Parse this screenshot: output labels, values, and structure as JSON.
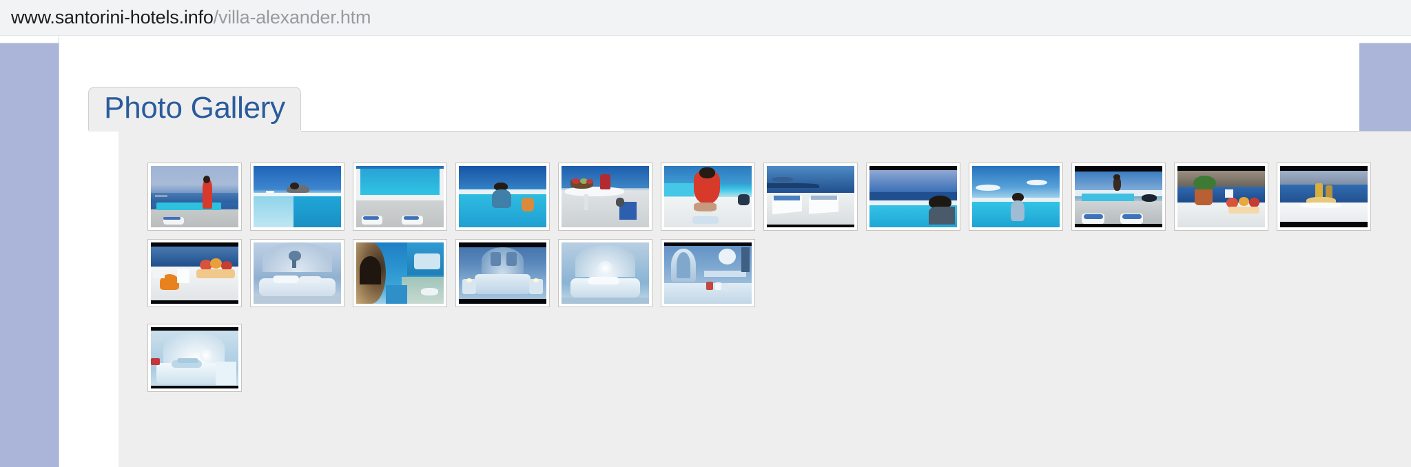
{
  "browser": {
    "url_domain": "www.santorini-hotels.info",
    "url_path": "/villa-alexander.htm"
  },
  "page": {
    "tab_label": "Photo Gallery",
    "colors": {
      "page_background": "#abb5d9",
      "panel_background": "#eeeeee",
      "tab_text": "#2a5b9c",
      "thumb_border": "#c6c3c0",
      "urlbar_background": "#f1f3f5",
      "url_domain_text": "#1d1d1f",
      "url_path_text": "#9a9a9e"
    },
    "gallery": {
      "columns": 9,
      "thumbnail_count": 19,
      "thumbnails": [
        {
          "n": 1,
          "alt": "Woman in red dress standing on pool deck overlooking caldera"
        },
        {
          "n": 2,
          "alt": "Woman in sun hat diving into infinity pool"
        },
        {
          "n": 3,
          "alt": "Empty infinity pool with blue sun loungers"
        },
        {
          "n": 4,
          "alt": "Woman in hat sitting in infinity pool facing the sea"
        },
        {
          "n": 5,
          "alt": "White table with fruit bowl and red jug on terrace"
        },
        {
          "n": 6,
          "alt": "Woman in red kneeling on pool edge"
        },
        {
          "n": 7,
          "alt": "Terrace with white deck chairs and sea view"
        },
        {
          "n": 8,
          "alt": "Person in sun hat lounging by the pool, sea view"
        },
        {
          "n": 9,
          "alt": "Woman standing in infinity pool with sky and clouds"
        },
        {
          "n": 10,
          "alt": "Person stretching by the pool at sunrise with loungers"
        },
        {
          "n": 11,
          "alt": "Potted plant and breakfast spread on caldera terrace"
        },
        {
          "n": 12,
          "alt": "Breakfast table with bottles overlooking Santorini caldera"
        },
        {
          "n": 13,
          "alt": "Breakfast tray with fruit, flowers and pastries"
        },
        {
          "n": 14,
          "alt": "Cave-style bedroom with white vaulted ceiling"
        },
        {
          "n": 15,
          "alt": "Blue cave bedroom with arched alcove and washbasin"
        },
        {
          "n": 16,
          "alt": "Blue bedroom with candles on side tables"
        },
        {
          "n": 17,
          "alt": "Softly lit white bedroom with vaulted ceiling"
        },
        {
          "n": 18,
          "alt": "Bathroom with arched window and blue walls"
        },
        {
          "n": 19,
          "alt": "White bedroom with folded towels on bed"
        }
      ]
    }
  }
}
